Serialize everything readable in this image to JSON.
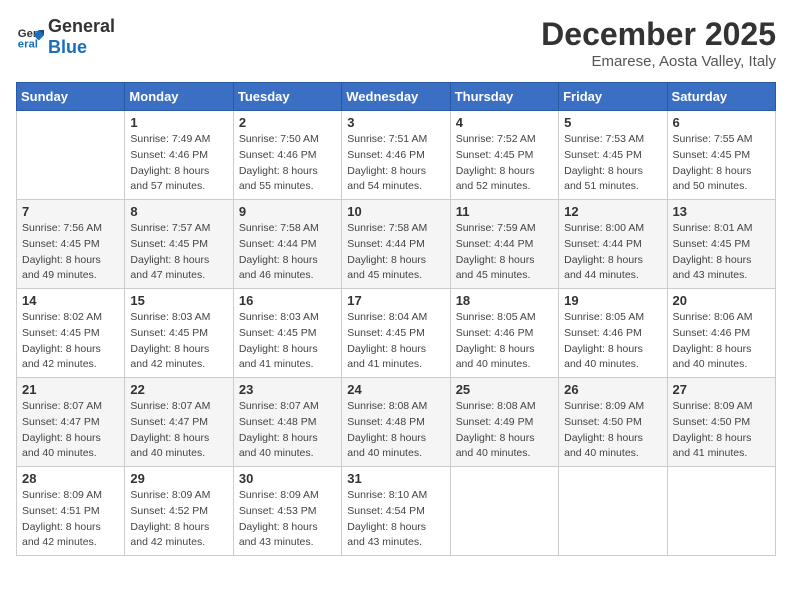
{
  "logo": {
    "general": "General",
    "blue": "Blue"
  },
  "title": {
    "month": "December 2025",
    "location": "Emarese, Aosta Valley, Italy"
  },
  "weekdays": [
    "Sunday",
    "Monday",
    "Tuesday",
    "Wednesday",
    "Thursday",
    "Friday",
    "Saturday"
  ],
  "weeks": [
    [
      {
        "day": "",
        "sunrise": "",
        "sunset": "",
        "daylight": ""
      },
      {
        "day": "1",
        "sunrise": "Sunrise: 7:49 AM",
        "sunset": "Sunset: 4:46 PM",
        "daylight": "Daylight: 8 hours and 57 minutes."
      },
      {
        "day": "2",
        "sunrise": "Sunrise: 7:50 AM",
        "sunset": "Sunset: 4:46 PM",
        "daylight": "Daylight: 8 hours and 55 minutes."
      },
      {
        "day": "3",
        "sunrise": "Sunrise: 7:51 AM",
        "sunset": "Sunset: 4:46 PM",
        "daylight": "Daylight: 8 hours and 54 minutes."
      },
      {
        "day": "4",
        "sunrise": "Sunrise: 7:52 AM",
        "sunset": "Sunset: 4:45 PM",
        "daylight": "Daylight: 8 hours and 52 minutes."
      },
      {
        "day": "5",
        "sunrise": "Sunrise: 7:53 AM",
        "sunset": "Sunset: 4:45 PM",
        "daylight": "Daylight: 8 hours and 51 minutes."
      },
      {
        "day": "6",
        "sunrise": "Sunrise: 7:55 AM",
        "sunset": "Sunset: 4:45 PM",
        "daylight": "Daylight: 8 hours and 50 minutes."
      }
    ],
    [
      {
        "day": "7",
        "sunrise": "Sunrise: 7:56 AM",
        "sunset": "Sunset: 4:45 PM",
        "daylight": "Daylight: 8 hours and 49 minutes."
      },
      {
        "day": "8",
        "sunrise": "Sunrise: 7:57 AM",
        "sunset": "Sunset: 4:45 PM",
        "daylight": "Daylight: 8 hours and 47 minutes."
      },
      {
        "day": "9",
        "sunrise": "Sunrise: 7:58 AM",
        "sunset": "Sunset: 4:44 PM",
        "daylight": "Daylight: 8 hours and 46 minutes."
      },
      {
        "day": "10",
        "sunrise": "Sunrise: 7:58 AM",
        "sunset": "Sunset: 4:44 PM",
        "daylight": "Daylight: 8 hours and 45 minutes."
      },
      {
        "day": "11",
        "sunrise": "Sunrise: 7:59 AM",
        "sunset": "Sunset: 4:44 PM",
        "daylight": "Daylight: 8 hours and 45 minutes."
      },
      {
        "day": "12",
        "sunrise": "Sunrise: 8:00 AM",
        "sunset": "Sunset: 4:44 PM",
        "daylight": "Daylight: 8 hours and 44 minutes."
      },
      {
        "day": "13",
        "sunrise": "Sunrise: 8:01 AM",
        "sunset": "Sunset: 4:45 PM",
        "daylight": "Daylight: 8 hours and 43 minutes."
      }
    ],
    [
      {
        "day": "14",
        "sunrise": "Sunrise: 8:02 AM",
        "sunset": "Sunset: 4:45 PM",
        "daylight": "Daylight: 8 hours and 42 minutes."
      },
      {
        "day": "15",
        "sunrise": "Sunrise: 8:03 AM",
        "sunset": "Sunset: 4:45 PM",
        "daylight": "Daylight: 8 hours and 42 minutes."
      },
      {
        "day": "16",
        "sunrise": "Sunrise: 8:03 AM",
        "sunset": "Sunset: 4:45 PM",
        "daylight": "Daylight: 8 hours and 41 minutes."
      },
      {
        "day": "17",
        "sunrise": "Sunrise: 8:04 AM",
        "sunset": "Sunset: 4:45 PM",
        "daylight": "Daylight: 8 hours and 41 minutes."
      },
      {
        "day": "18",
        "sunrise": "Sunrise: 8:05 AM",
        "sunset": "Sunset: 4:46 PM",
        "daylight": "Daylight: 8 hours and 40 minutes."
      },
      {
        "day": "19",
        "sunrise": "Sunrise: 8:05 AM",
        "sunset": "Sunset: 4:46 PM",
        "daylight": "Daylight: 8 hours and 40 minutes."
      },
      {
        "day": "20",
        "sunrise": "Sunrise: 8:06 AM",
        "sunset": "Sunset: 4:46 PM",
        "daylight": "Daylight: 8 hours and 40 minutes."
      }
    ],
    [
      {
        "day": "21",
        "sunrise": "Sunrise: 8:07 AM",
        "sunset": "Sunset: 4:47 PM",
        "daylight": "Daylight: 8 hours and 40 minutes."
      },
      {
        "day": "22",
        "sunrise": "Sunrise: 8:07 AM",
        "sunset": "Sunset: 4:47 PM",
        "daylight": "Daylight: 8 hours and 40 minutes."
      },
      {
        "day": "23",
        "sunrise": "Sunrise: 8:07 AM",
        "sunset": "Sunset: 4:48 PM",
        "daylight": "Daylight: 8 hours and 40 minutes."
      },
      {
        "day": "24",
        "sunrise": "Sunrise: 8:08 AM",
        "sunset": "Sunset: 4:48 PM",
        "daylight": "Daylight: 8 hours and 40 minutes."
      },
      {
        "day": "25",
        "sunrise": "Sunrise: 8:08 AM",
        "sunset": "Sunset: 4:49 PM",
        "daylight": "Daylight: 8 hours and 40 minutes."
      },
      {
        "day": "26",
        "sunrise": "Sunrise: 8:09 AM",
        "sunset": "Sunset: 4:50 PM",
        "daylight": "Daylight: 8 hours and 40 minutes."
      },
      {
        "day": "27",
        "sunrise": "Sunrise: 8:09 AM",
        "sunset": "Sunset: 4:50 PM",
        "daylight": "Daylight: 8 hours and 41 minutes."
      }
    ],
    [
      {
        "day": "28",
        "sunrise": "Sunrise: 8:09 AM",
        "sunset": "Sunset: 4:51 PM",
        "daylight": "Daylight: 8 hours and 42 minutes."
      },
      {
        "day": "29",
        "sunrise": "Sunrise: 8:09 AM",
        "sunset": "Sunset: 4:52 PM",
        "daylight": "Daylight: 8 hours and 42 minutes."
      },
      {
        "day": "30",
        "sunrise": "Sunrise: 8:09 AM",
        "sunset": "Sunset: 4:53 PM",
        "daylight": "Daylight: 8 hours and 43 minutes."
      },
      {
        "day": "31",
        "sunrise": "Sunrise: 8:10 AM",
        "sunset": "Sunset: 4:54 PM",
        "daylight": "Daylight: 8 hours and 43 minutes."
      },
      {
        "day": "",
        "sunrise": "",
        "sunset": "",
        "daylight": ""
      },
      {
        "day": "",
        "sunrise": "",
        "sunset": "",
        "daylight": ""
      },
      {
        "day": "",
        "sunrise": "",
        "sunset": "",
        "daylight": ""
      }
    ]
  ]
}
